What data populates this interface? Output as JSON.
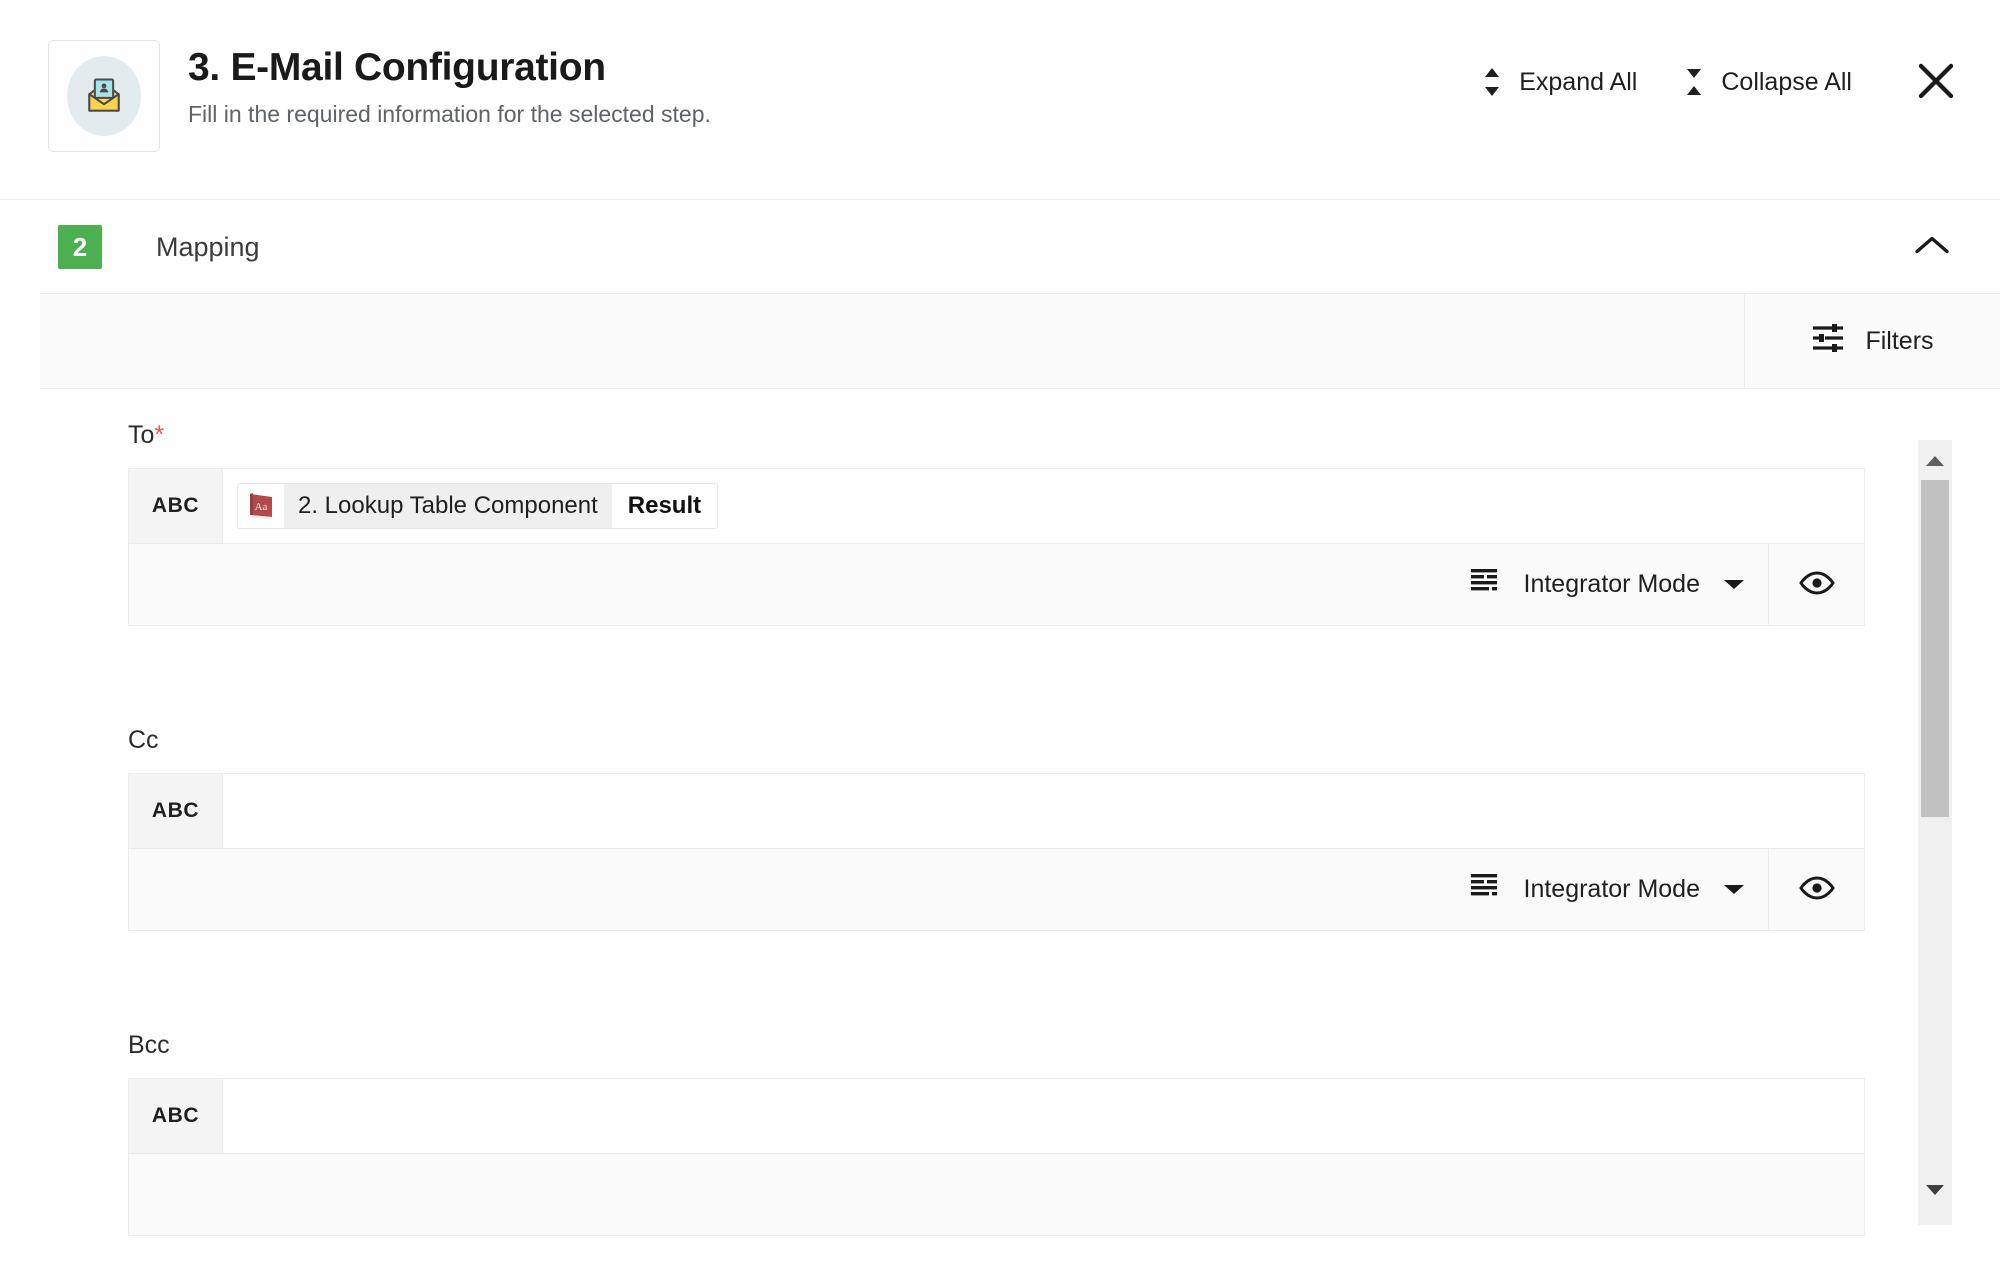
{
  "header": {
    "title": "3. E-Mail Configuration",
    "subtitle": "Fill in the required information for the selected step.",
    "icon": "email-envelope-icon",
    "actions": {
      "expand_all": "Expand All",
      "expand_all_icon": "unfold-more-icon",
      "collapse_all": "Collapse All",
      "collapse_all_icon": "unfold-less-icon",
      "close_icon": "close-icon"
    }
  },
  "section": {
    "badge": "2",
    "badge_color": "#4caf50",
    "title": "Mapping",
    "chevron_icon": "chevron-up-icon",
    "expanded": true
  },
  "toolbar": {
    "filters_label": "Filters",
    "filters_icon": "tune-sliders-icon"
  },
  "fields": [
    {
      "label": "To",
      "required": true,
      "type_badge": "ABC",
      "token": {
        "icon": "dictionary-book-icon",
        "source": "2. Lookup Table Component",
        "field": "Result"
      },
      "mode": "Integrator Mode",
      "mode_icon": "integrator-mode-icon",
      "mode_caret": "caret-down-icon",
      "preview_icon": "eye-visibility-icon"
    },
    {
      "label": "Cc",
      "required": false,
      "type_badge": "ABC",
      "token": null,
      "mode": "Integrator Mode",
      "mode_icon": "integrator-mode-icon",
      "mode_caret": "caret-down-icon",
      "preview_icon": "eye-visibility-icon"
    },
    {
      "label": "Bcc",
      "required": false,
      "type_badge": "ABC",
      "token": null,
      "mode": "",
      "mode_icon": "integrator-mode-icon",
      "mode_caret": "caret-down-icon",
      "preview_icon": "eye-visibility-icon"
    }
  ],
  "scrollbar": {
    "up_icon": "scroll-up-arrow-icon",
    "down_icon": "scroll-down-arrow-icon"
  },
  "colors": {
    "accent_green": "#4caf50",
    "required_red": "#ef5350",
    "token_red": "#b2494c"
  }
}
